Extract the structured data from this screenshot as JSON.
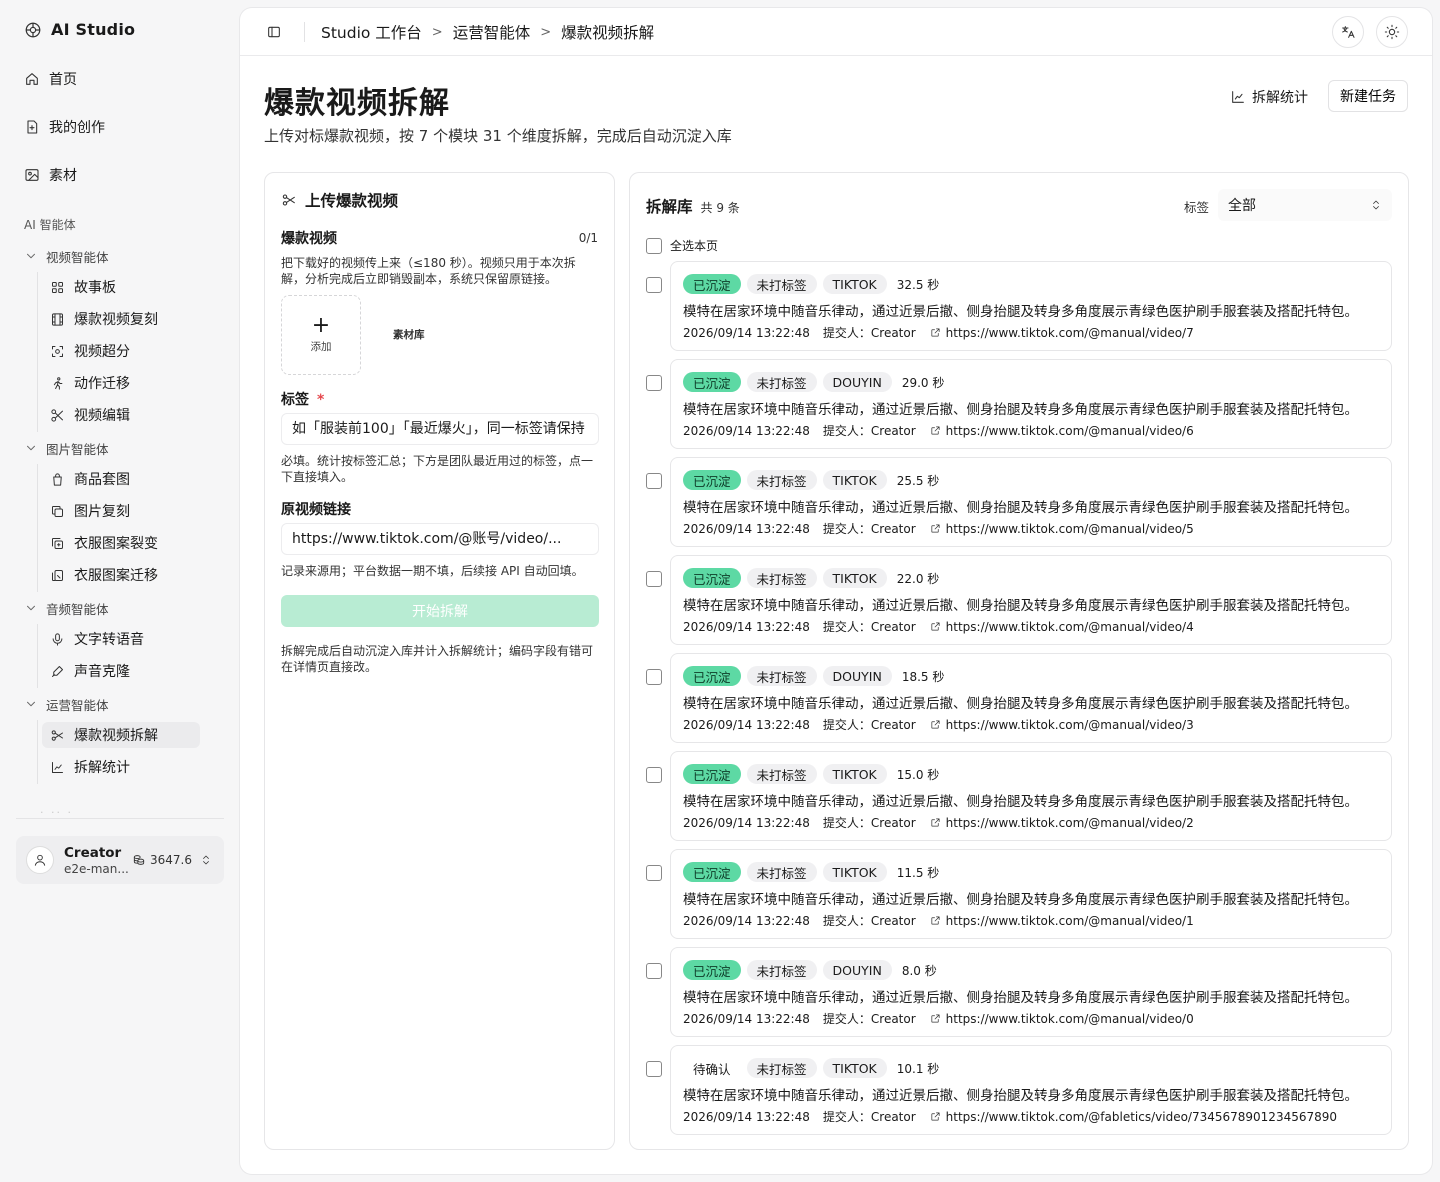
{
  "brand": {
    "name": "AI Studio"
  },
  "nav": {
    "home": "首页",
    "creations": "我的创作",
    "materials": "素材",
    "section_label": "AI 智能体",
    "groups": [
      {
        "label": "视频智能体",
        "items": [
          "故事板",
          "爆款视频复刻",
          "视频超分",
          "动作迁移",
          "视频编辑"
        ]
      },
      {
        "label": "图片智能体",
        "items": [
          "商品套图",
          "图片复刻",
          "衣服图案裂变",
          "衣服图案迁移"
        ]
      },
      {
        "label": "音频智能体",
        "items": [
          "文字转语音",
          "声音克隆"
        ]
      },
      {
        "label": "运营智能体",
        "items": [
          "爆款视频拆解",
          "拆解统计"
        ]
      }
    ],
    "faded_text": "· ·· ·"
  },
  "user": {
    "name": "Creator",
    "email": "e2e-man...",
    "credits": "3647.6"
  },
  "breadcrumb": [
    "Studio 工作台",
    "运营智能体",
    "爆款视频拆解"
  ],
  "page": {
    "title": "爆款视频拆解",
    "subtitle": "上传对标爆款视频，按 7 个模块 31 个维度拆解，完成后自动沉淀入库",
    "stats_link": "拆解统计",
    "new_task": "新建任务"
  },
  "upload": {
    "title": "上传爆款视频",
    "video_label": "爆款视频",
    "video_count": "0/1",
    "video_help": "把下载好的视频传上来（≤180 秒）。视频只用于本次拆解，分析完成后立即销毁副本，系统只保留原链接。",
    "add_label": "添加",
    "library_link": "素材库",
    "tag_label": "标签",
    "tag_required": "*",
    "tag_placeholder": "如「服装前100」「最近爆火」，同一标签请保持",
    "tag_help": "必填。统计按标签汇总；下方是团队最近用过的标签，点一下直接填入。",
    "link_label": "原视频链接",
    "link_placeholder": "https://www.tiktok.com/@账号/video/...",
    "link_help": "记录来源用；平台数据一期不填，后续接 API 自动回填。",
    "start_button": "开始拆解",
    "footer_help": "拆解完成后自动沉淀入库并计入拆解统计；编码字段有错可在详情页直接改。"
  },
  "library": {
    "title": "拆解库",
    "count": "共 9 条",
    "filter_label": "标签",
    "filter_value": "全部",
    "select_all": "全选本页",
    "submit_label": "提交人：",
    "rows": [
      {
        "status": "已沉淀",
        "status_type": "done",
        "tag": "未打标签",
        "platform": "TIKTOK",
        "duration": "32.5 秒",
        "desc": "模特在居家环境中随音乐律动，通过近景后撤、侧身抬腿及转身多角度展示青绿色医护刷手服套装及搭配托特包。",
        "time": "2026/09/14 13:22:48",
        "submitter": "Creator",
        "url": "https://www.tiktok.com/@manual/video/7"
      },
      {
        "status": "已沉淀",
        "status_type": "done",
        "tag": "未打标签",
        "platform": "DOUYIN",
        "duration": "29.0 秒",
        "desc": "模特在居家环境中随音乐律动，通过近景后撤、侧身抬腿及转身多角度展示青绿色医护刷手服套装及搭配托特包。",
        "time": "2026/09/14 13:22:48",
        "submitter": "Creator",
        "url": "https://www.tiktok.com/@manual/video/6"
      },
      {
        "status": "已沉淀",
        "status_type": "done",
        "tag": "未打标签",
        "platform": "TIKTOK",
        "duration": "25.5 秒",
        "desc": "模特在居家环境中随音乐律动，通过近景后撤、侧身抬腿及转身多角度展示青绿色医护刷手服套装及搭配托特包。",
        "time": "2026/09/14 13:22:48",
        "submitter": "Creator",
        "url": "https://www.tiktok.com/@manual/video/5"
      },
      {
        "status": "已沉淀",
        "status_type": "done",
        "tag": "未打标签",
        "platform": "TIKTOK",
        "duration": "22.0 秒",
        "desc": "模特在居家环境中随音乐律动，通过近景后撤、侧身抬腿及转身多角度展示青绿色医护刷手服套装及搭配托特包。",
        "time": "2026/09/14 13:22:48",
        "submitter": "Creator",
        "url": "https://www.tiktok.com/@manual/video/4"
      },
      {
        "status": "已沉淀",
        "status_type": "done",
        "tag": "未打标签",
        "platform": "DOUYIN",
        "duration": "18.5 秒",
        "desc": "模特在居家环境中随音乐律动，通过近景后撤、侧身抬腿及转身多角度展示青绿色医护刷手服套装及搭配托特包。",
        "time": "2026/09/14 13:22:48",
        "submitter": "Creator",
        "url": "https://www.tiktok.com/@manual/video/3"
      },
      {
        "status": "已沉淀",
        "status_type": "done",
        "tag": "未打标签",
        "platform": "TIKTOK",
        "duration": "15.0 秒",
        "desc": "模特在居家环境中随音乐律动，通过近景后撤、侧身抬腿及转身多角度展示青绿色医护刷手服套装及搭配托特包。",
        "time": "2026/09/14 13:22:48",
        "submitter": "Creator",
        "url": "https://www.tiktok.com/@manual/video/2"
      },
      {
        "status": "已沉淀",
        "status_type": "done",
        "tag": "未打标签",
        "platform": "TIKTOK",
        "duration": "11.5 秒",
        "desc": "模特在居家环境中随音乐律动，通过近景后撤、侧身抬腿及转身多角度展示青绿色医护刷手服套装及搭配托特包。",
        "time": "2026/09/14 13:22:48",
        "submitter": "Creator",
        "url": "https://www.tiktok.com/@manual/video/1"
      },
      {
        "status": "已沉淀",
        "status_type": "done",
        "tag": "未打标签",
        "platform": "DOUYIN",
        "duration": "8.0 秒",
        "desc": "模特在居家环境中随音乐律动，通过近景后撤、侧身抬腿及转身多角度展示青绿色医护刷手服套装及搭配托特包。",
        "time": "2026/09/14 13:22:48",
        "submitter": "Creator",
        "url": "https://www.tiktok.com/@manual/video/0"
      },
      {
        "status": "待确认",
        "status_type": "pending",
        "tag": "未打标签",
        "platform": "TIKTOK",
        "duration": "10.1 秒",
        "desc": "模特在居家环境中随音乐律动，通过近景后撤、侧身抬腿及转身多角度展示青绿色医护刷手服套装及搭配托特包。",
        "time": "2026/09/14 13:22:48",
        "submitter": "Creator",
        "url": "https://www.tiktok.com/@fabletics/video/7345678901234567890"
      }
    ]
  },
  "colors": {
    "accent_green": "#5dd9a4",
    "start_button": "#b8ecd3",
    "tag_gray": "#f0f0f2"
  },
  "icons": [
    "brand-icon",
    "home-icon",
    "creation-icon",
    "image-icon",
    "chevron-down-icon",
    "sidebar-toggle-icon",
    "translate-icon",
    "sun-icon",
    "chart-icon",
    "scissors-icon",
    "external-link-icon",
    "user-icon",
    "coins-icon",
    "chevron-up-down-icon"
  ]
}
